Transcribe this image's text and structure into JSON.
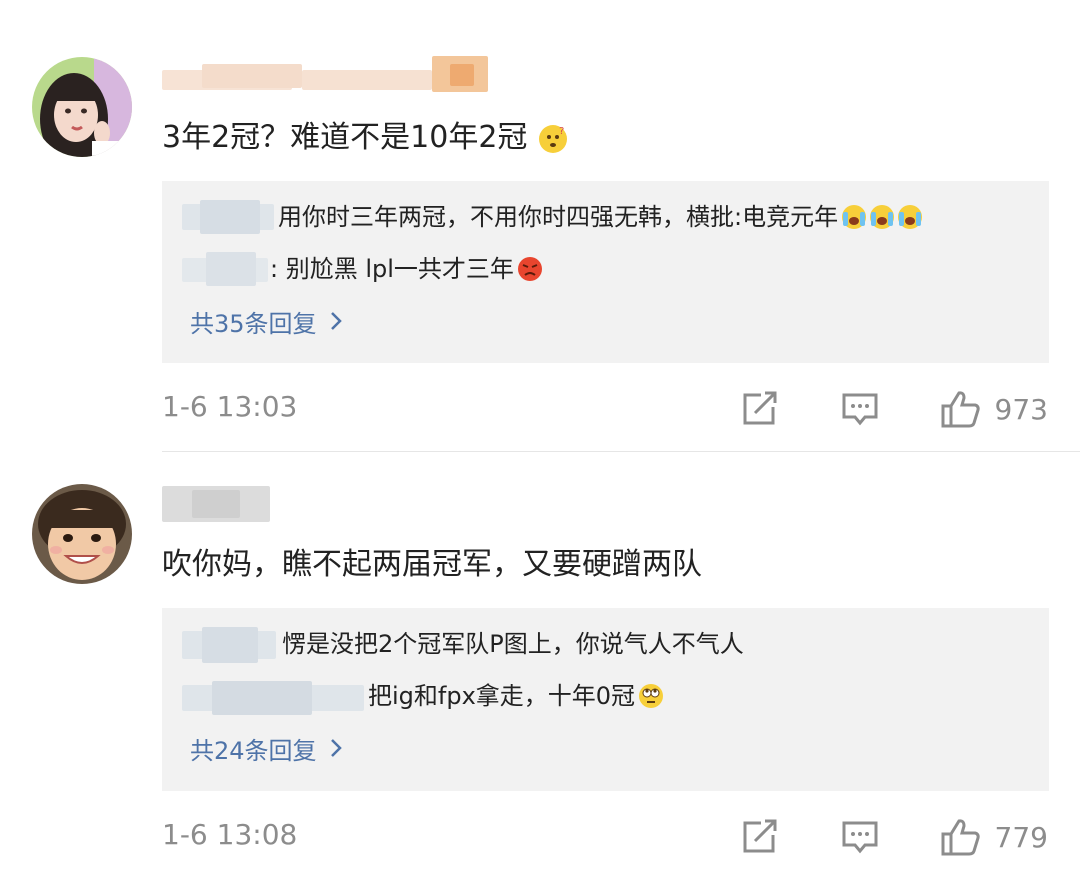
{
  "comments": [
    {
      "text": "3年2冠？难道不是10年2冠",
      "replies": [
        {
          "text": "用你时三年两冠，不用你时四强无韩，横批:电竞元年"
        },
        {
          "text": ": 别尬黑 lpl一共才三年"
        }
      ],
      "more_label": "共35条回复",
      "time": "1-6 13:03",
      "likes": "973"
    },
    {
      "text": "吹你妈，瞧不起两届冠军，又要硬蹭两队",
      "replies": [
        {
          "text": "愣是没把2个冠军队P图上，你说气人不气人"
        },
        {
          "text": "把ig和fpx拿走，十年0冠"
        }
      ],
      "more_label": "共24条回复",
      "time": "1-6 13:08",
      "likes": "779"
    }
  ],
  "icons": {
    "share": "share-icon",
    "comment": "comment-icon",
    "like": "thumbs-up-icon",
    "chevron": "chevron-right-icon"
  },
  "colors": {
    "link": "#4e73a8",
    "meta": "#8c8c8c",
    "reply_bg": "#f2f2f2"
  }
}
